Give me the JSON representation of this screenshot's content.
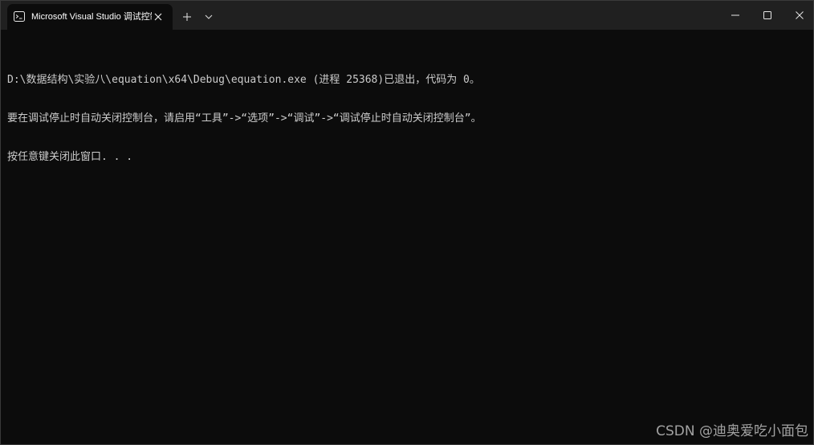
{
  "window": {
    "tab_title": "Microsoft Visual Studio 调试控制台",
    "tab_icon": "terminal-icon",
    "new_tab_icon": "plus-icon",
    "dropdown_icon": "chevron-down-icon",
    "minimize_icon": "minimize-icon",
    "maximize_icon": "maximize-icon",
    "close_icon": "close-icon"
  },
  "console": {
    "lines": [
      "D:\\数据结构\\实验八\\equation\\x64\\Debug\\equation.exe (进程 25368)已退出，代码为 0。",
      "要在调试停止时自动关闭控制台，请启用“工具”->“选项”->“调试”->“调试停止时自动关闭控制台”。",
      "按任意键关闭此窗口. . ."
    ]
  },
  "watermark": {
    "text": "CSDN @迪奥爱吃小面包"
  },
  "colors": {
    "titlebar": "#202020",
    "background": "#0c0c0c",
    "text": "#cccccc"
  }
}
